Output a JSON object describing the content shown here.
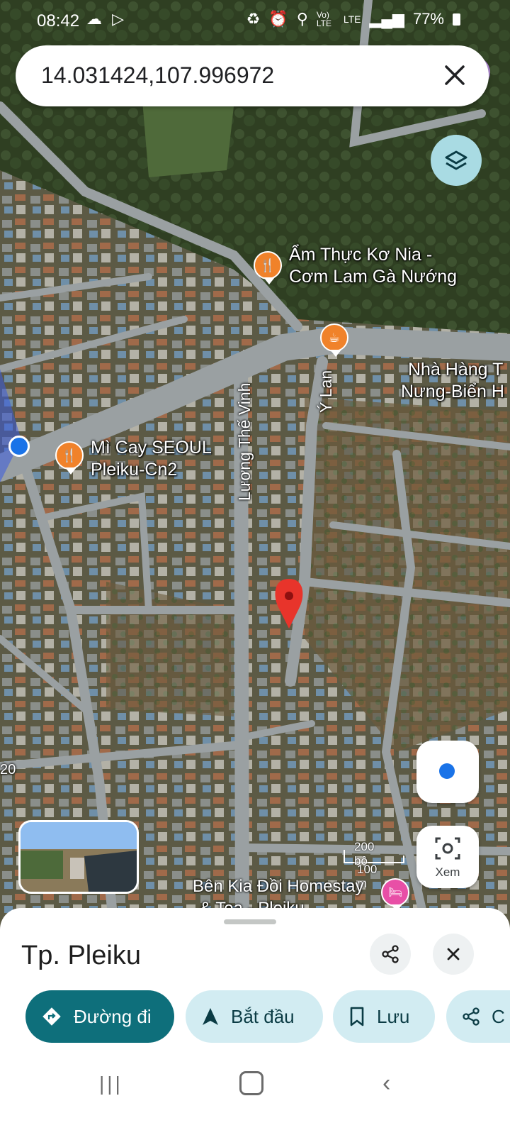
{
  "status_bar": {
    "time": "08:42",
    "battery": "77%",
    "network": "LTE",
    "volte": "Vo) LTE",
    "icons": [
      "cloud-icon",
      "play-store-icon",
      "recycle-icon",
      "alarm-icon",
      "location-icon",
      "signal-icon",
      "battery-icon"
    ]
  },
  "search": {
    "query": "14.031424,107.996972"
  },
  "map": {
    "pois": [
      {
        "line1": "Ẩm Thực Kơ Nia -",
        "line2": "Cơm Lam Gà Nướng",
        "icon": "restaurant-icon"
      },
      {
        "line1": "",
        "line2": "",
        "icon": "cafe-icon"
      },
      {
        "line1": "Nhà Hàng T",
        "line2": "Nưng-Biển H",
        "icon": ""
      },
      {
        "line1": "Mì Cay SEOUL",
        "line2": "Pleiku-Cn2",
        "icon": "restaurant-icon"
      },
      {
        "line1": "Bên Kia Đồi Homestay",
        "line2": "& Tea - Pleiku",
        "icon": "hotel-icon"
      }
    ],
    "streets": [
      "Lương Thế Vinh",
      "Ý Lan"
    ],
    "edge_label": "20",
    "scale": {
      "feet": "200 bộ",
      "meters": "100 m"
    },
    "lens_label": "Xem"
  },
  "sheet": {
    "title": "Tp. Pleiku",
    "actions": [
      {
        "label": "Đường đi",
        "icon": "directions-icon"
      },
      {
        "label": "Bắt đầu",
        "icon": "navigation-icon"
      },
      {
        "label": "Lưu",
        "icon": "bookmark-icon"
      },
      {
        "label": "C",
        "icon": "share-icon"
      }
    ]
  },
  "colors": {
    "accent": "#0e6f7b",
    "chip": "#d2ecf2",
    "poi_orange": "#f0822a",
    "poi_pink": "#e84fa6",
    "pin_red": "#e8342b",
    "location_blue": "#1a73e8"
  }
}
